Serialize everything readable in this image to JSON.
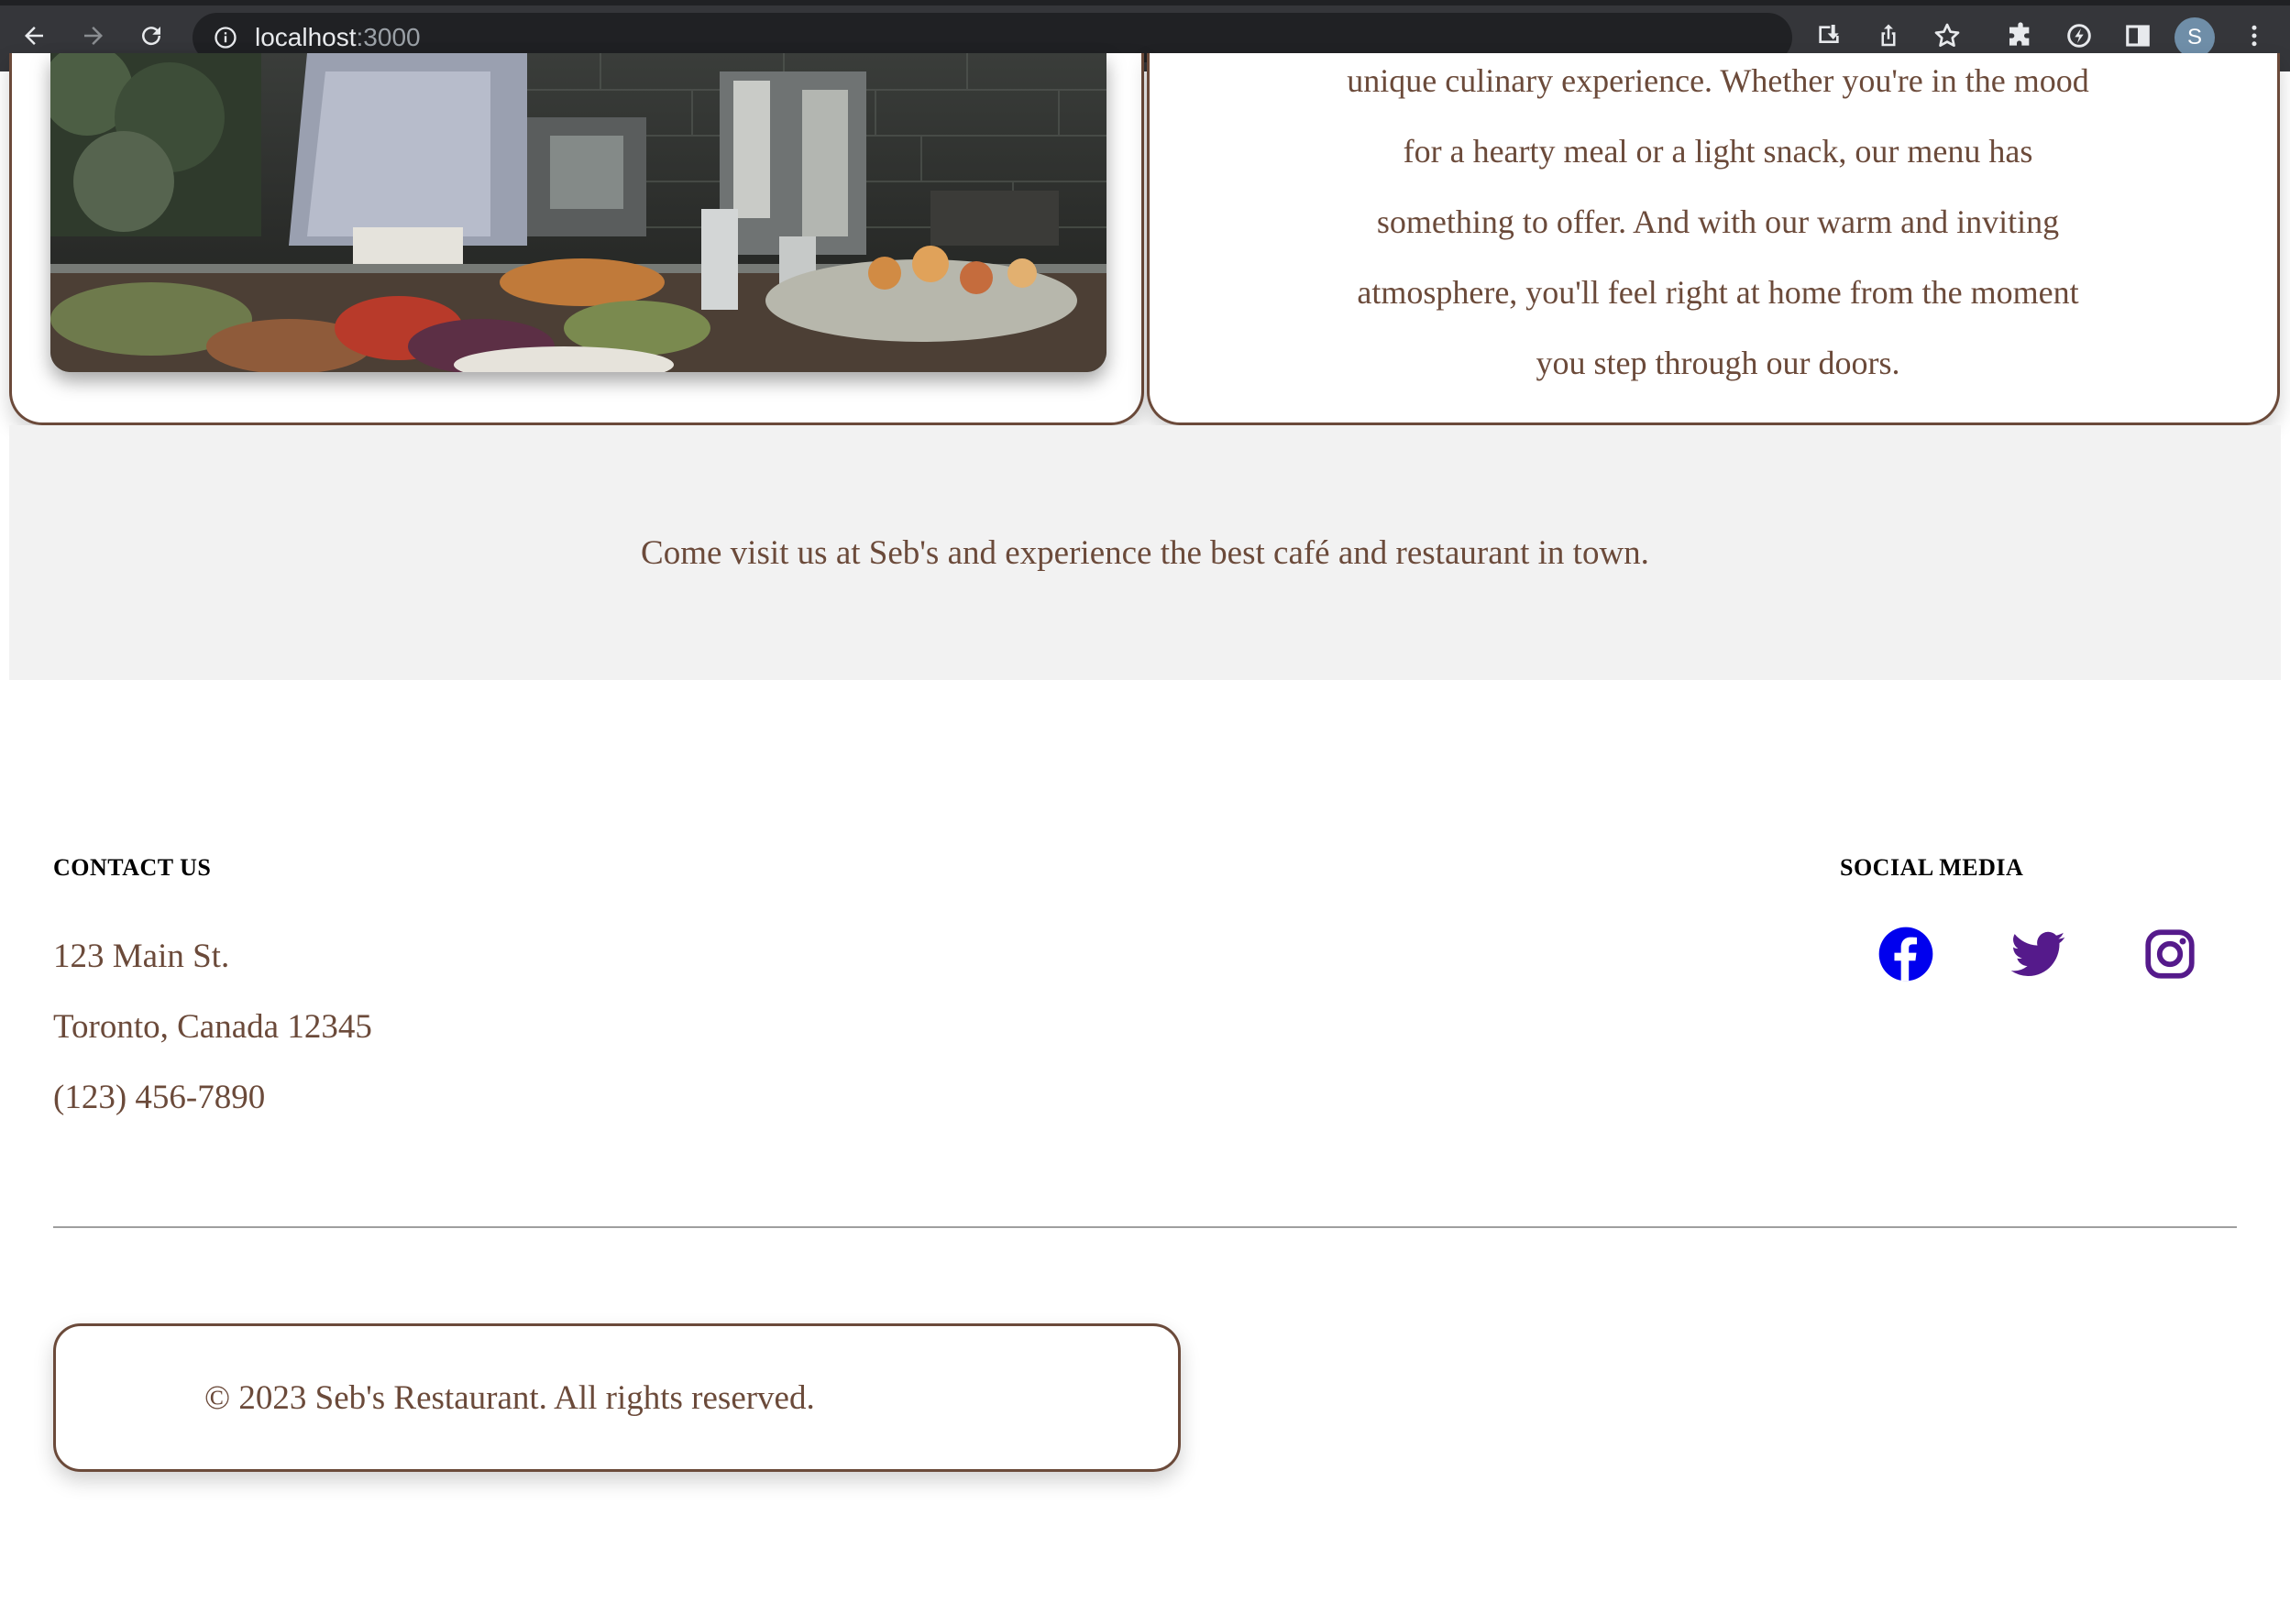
{
  "browser": {
    "url_host": "localhost",
    "url_port": ":3000",
    "profile_initial": "S"
  },
  "about": {
    "lines": [
      "unique culinary experience. Whether you're in the mood",
      "for a hearty meal or a light snack, our menu has",
      "something to offer. And with our warm and inviting",
      "atmosphere, you'll feel right at home from the moment",
      "you step through our doors."
    ]
  },
  "visit_message": "Come visit us at Seb's and experience the best café and restaurant in town.",
  "footer": {
    "contact_heading": "CONTACT US",
    "address_line1": "123 Main St.",
    "address_line2": "Toronto, Canada 12345",
    "phone": "(123) 456-7890",
    "social_heading": "SOCIAL MEDIA",
    "social_icons": [
      "facebook-icon",
      "twitter-icon",
      "instagram-icon"
    ],
    "copyright": "© 2023 Seb's Restaurant. All rights reserved."
  },
  "colors": {
    "brand_brown": "#6b4a3a",
    "band_gray": "#f2f2f2",
    "facebook_blue": "#0000ee",
    "visited_purple": "#551a8b"
  }
}
